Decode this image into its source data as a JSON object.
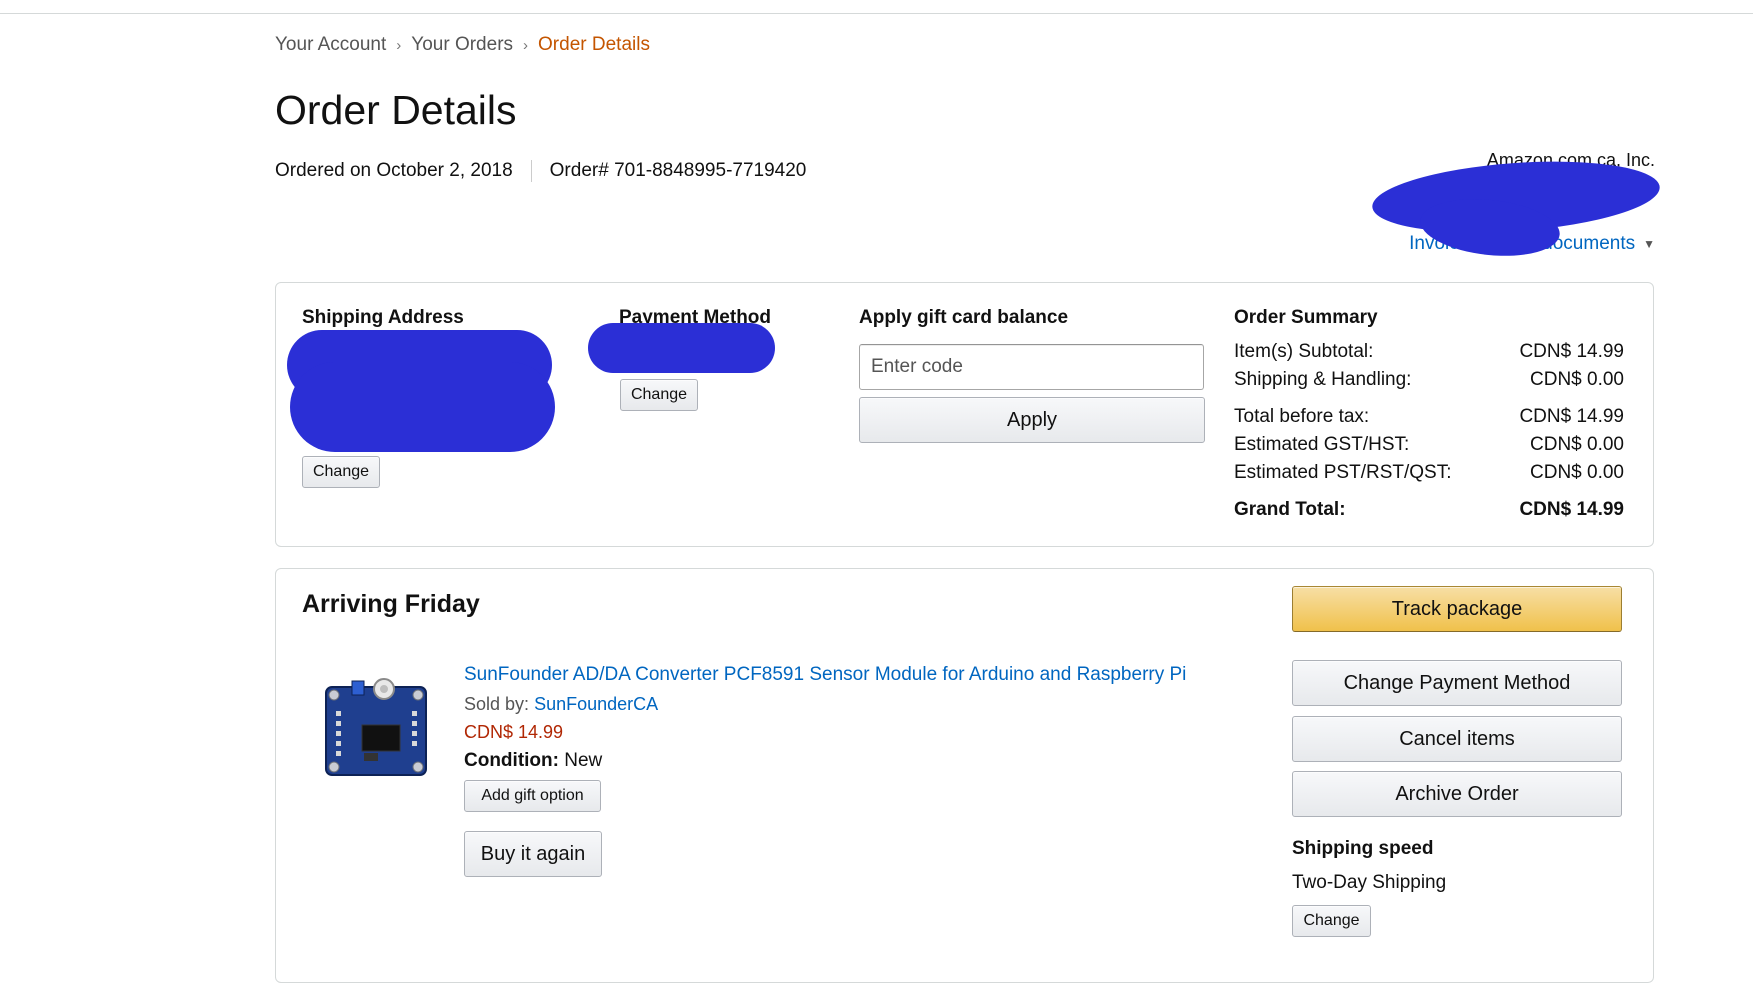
{
  "breadcrumb": {
    "items": [
      "Your Account",
      "Your Orders",
      "Order Details"
    ],
    "separator": "›"
  },
  "page_title": "Order Details",
  "order_meta": {
    "ordered_on": "Ordered on October 2, 2018",
    "order_number": "Order# 701-8848995-7719420"
  },
  "seller": "Amazon.com.ca, Inc.",
  "invoice_link": "Invoice    rintable documents",
  "colors": {
    "link": "#0066c0",
    "price": "#b12704",
    "breadcrumb_current": "#c45500",
    "redaction": "#2b2fd6",
    "track_button": "#f0c14b"
  },
  "shipping_address": {
    "title": "Shipping Address",
    "change_label": "Change"
  },
  "payment_method": {
    "title": "Payment Method",
    "change_label": "Change"
  },
  "gift_card": {
    "title": "Apply gift card balance",
    "placeholder": "Enter code",
    "apply_label": "Apply"
  },
  "order_summary": {
    "title": "Order Summary",
    "rows": [
      {
        "label": "Item(s) Subtotal:",
        "value": "CDN$ 14.99"
      },
      {
        "label": "Shipping & Handling:",
        "value": "CDN$ 0.00"
      },
      {
        "label": "Total before tax:",
        "value": "CDN$ 14.99"
      },
      {
        "label": "Estimated GST/HST:",
        "value": "CDN$ 0.00"
      },
      {
        "label": "Estimated PST/RST/QST:",
        "value": "CDN$ 0.00"
      }
    ],
    "grand_total_label": "Grand Total:",
    "grand_total_value": "CDN$ 14.99"
  },
  "shipment": {
    "status": "Arriving Friday",
    "product": {
      "title": "SunFounder AD/DA Converter PCF8591 Sensor Module for Arduino and Raspberry Pi",
      "sold_by_label": "Sold by:",
      "seller": "SunFounderCA",
      "price": "CDN$ 14.99",
      "condition_label": "Condition:",
      "condition_value": "New",
      "gift_option_label": "Add gift option",
      "buy_again_label": "Buy it again"
    },
    "actions": {
      "track": "Track package",
      "change_payment": "Change Payment Method",
      "cancel": "Cancel items",
      "archive": "Archive Order"
    },
    "shipping_speed_title": "Shipping speed",
    "shipping_speed_value": "Two-Day Shipping",
    "shipping_speed_change": "Change"
  }
}
